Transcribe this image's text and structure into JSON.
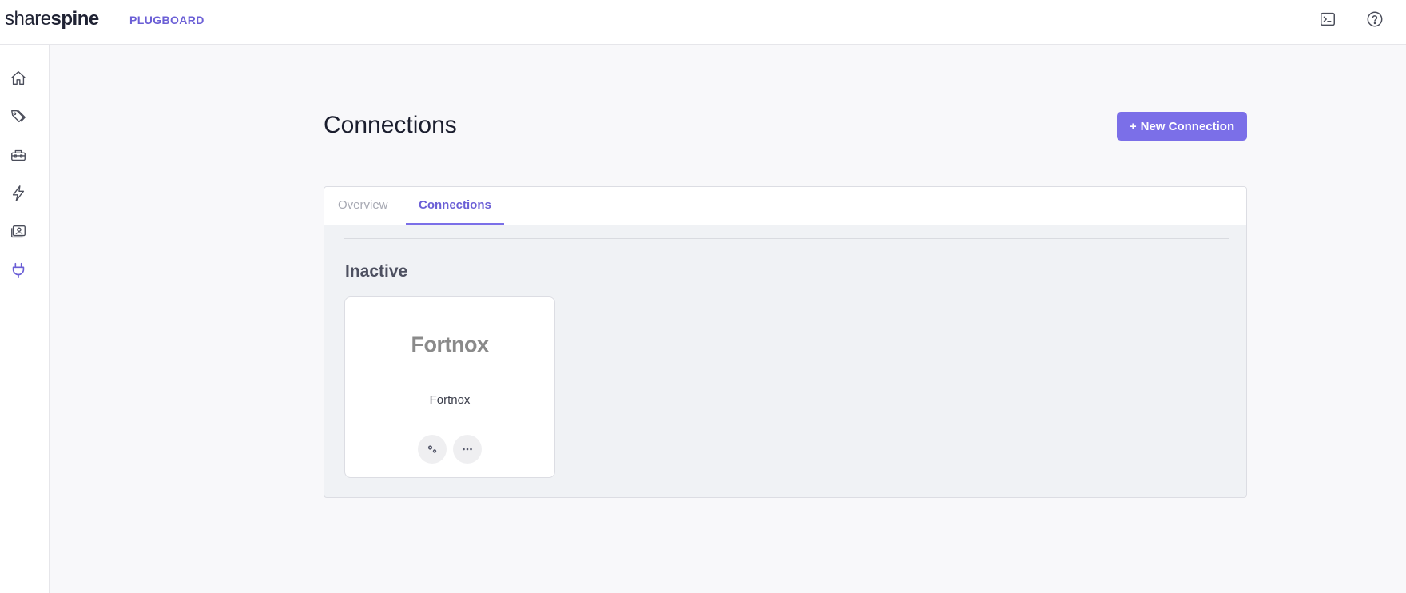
{
  "app": {
    "brand_light": "share",
    "brand_bold": "spine",
    "product": "PLUGBOARD"
  },
  "header_icons": [
    "terminal-icon",
    "help-icon"
  ],
  "sidebar": {
    "items": [
      {
        "icon": "home-icon",
        "active": false
      },
      {
        "icon": "tags-icon",
        "active": false
      },
      {
        "icon": "toolbox-icon",
        "active": false
      },
      {
        "icon": "lightning-icon",
        "active": false
      },
      {
        "icon": "contacts-icon",
        "active": false
      },
      {
        "icon": "plug-icon",
        "active": true
      }
    ]
  },
  "page": {
    "title": "Connections",
    "new_button": {
      "plus": "+",
      "label": "New Connection"
    }
  },
  "tabs": [
    {
      "label": "Overview",
      "active": false
    },
    {
      "label": "Connections",
      "active": true
    }
  ],
  "section": {
    "title": "Inactive",
    "cards": [
      {
        "logo_text": "Fortnox",
        "name": "Fortnox",
        "actions": [
          "settings-icon",
          "more-icon"
        ]
      }
    ]
  },
  "colors": {
    "accent": "#7b6fe8",
    "accent_text": "#6b5fd6",
    "panel_bg": "#f0f2f5",
    "page_bg": "#f8f8fa"
  }
}
